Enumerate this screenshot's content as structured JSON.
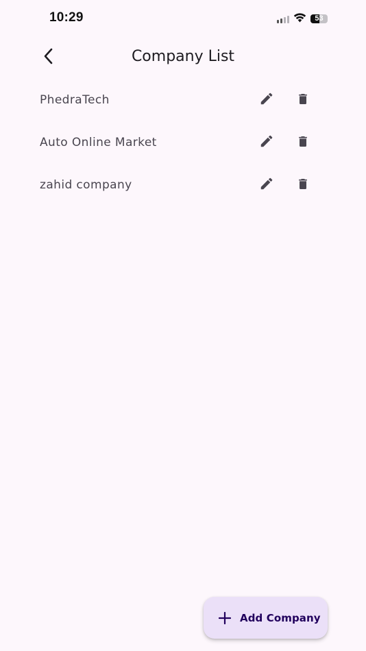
{
  "status_bar": {
    "time": "10:29",
    "battery": "53",
    "battery_level_percent": 53
  },
  "app_bar": {
    "title": "Company List",
    "back_icon": "chevron-left-icon"
  },
  "companies": [
    {
      "name": "PhedraTech"
    },
    {
      "name": "Auto Online Market"
    },
    {
      "name": "zahid company"
    }
  ],
  "row_actions": {
    "edit_icon": "pencil-icon",
    "delete_icon": "trash-icon"
  },
  "fab": {
    "label": "Add Company",
    "icon": "plus-icon"
  },
  "colors": {
    "background": "#fdf7fc",
    "fab_background": "#ebe0f8",
    "fab_text": "#21005d",
    "icon": "#49454f",
    "text": "#49454f"
  }
}
